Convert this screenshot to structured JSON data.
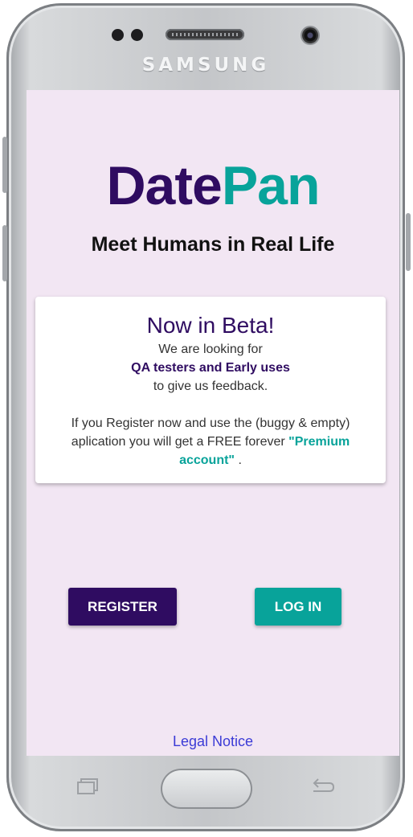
{
  "device": {
    "brand": "SAMSUNG"
  },
  "app": {
    "logo_part1": "Date",
    "logo_part2": "Pan",
    "tagline": "Meet Humans in Real Life"
  },
  "beta_card": {
    "title": "Now in Beta!",
    "line1": "We are looking for",
    "line2": "QA testers and Early uses",
    "line3": "to give us feedback.",
    "line4": "If you Register now and use the (buggy & empty)",
    "line5_prefix": "aplication you will get a FREE forever ",
    "line5_highlight": "\"Premium",
    "line6_highlight": "account\"",
    "line6_suffix": " ."
  },
  "actions": {
    "register_label": "REGISTER",
    "login_label": "LOG IN"
  },
  "footer": {
    "legal_label": "Legal Notice"
  },
  "colors": {
    "primary": "#2f0c61",
    "accent": "#08a39a",
    "screen_bg": "#f2e6f3",
    "link": "#3b3bd6"
  },
  "icons": {
    "recent_apps": "recent-apps-icon",
    "back": "back-icon"
  }
}
